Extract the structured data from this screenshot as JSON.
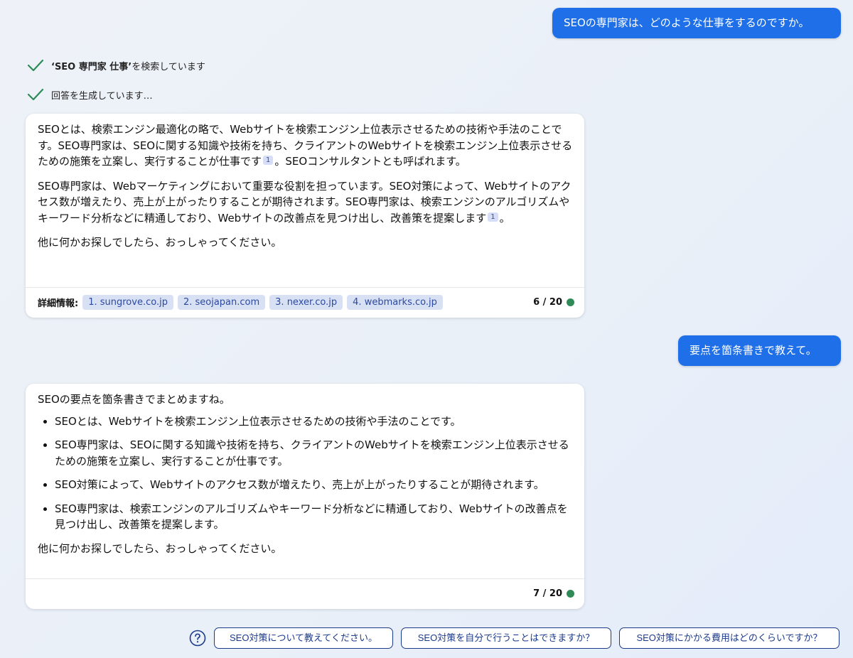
{
  "conversation": {
    "user_message_1": "SEOの専門家は、どのような仕事をするのですか。",
    "status_1_query": "‘SEO 専門家 仕事’",
    "status_1_suffix": " を検索しています",
    "status_2": "回答を生成しています…",
    "answer_1": {
      "p1_a": "SEOとは、検索エンジン最適化の略で、Webサイトを検索エンジン上位表示させるための技術や手法のことです。SEO専門家は、SEOに関する知識や技術を持ち、クライアントのWebサイトを検索エンジン上位表示させるための施策を立案し、実行することが仕事です",
      "p1_ref": "1",
      "p1_b": "。SEOコンサルタントとも呼ばれます。",
      "p2_a": "SEO専門家は、Webマーケティングにおいて重要な役割を担っています。SEO対策によって、Webサイトのアクセス数が増えたり、売上が上がったりすることが期待されます。SEO専門家は、検索エンジンのアルゴリズムやキーワード分析などに精通しており、Webサイトの改善点を見つけ出し、改善策を提案します",
      "p2_ref": "1",
      "p2_b": "。",
      "p3": "他に何かお探しでしたら、おっしゃってください。",
      "footer_label": "詳細情報:",
      "sources": [
        "1. sungrove.co.jp",
        "2. seojapan.com",
        "3. nexer.co.jp",
        "4. webmarks.co.jp"
      ],
      "counter": "6 / 20"
    },
    "user_message_2": "要点を箇条書きで教えて。",
    "answer_2": {
      "intro": "SEOの要点を箇条書きでまとめますね。",
      "bullets": [
        "SEOとは、Webサイトを検索エンジン上位表示させるための技術や手法のことです。",
        "SEO専門家は、SEOに関する知識や技術を持ち、クライアントのWebサイトを検索エンジン上位表示させるための施策を立案し、実行することが仕事です。",
        "SEO対策によって、Webサイトのアクセス数が増えたり、売上が上がったりすることが期待されます。",
        "SEO専門家は、検索エンジンのアルゴリズムやキーワード分析などに精通しており、Webサイトの改善点を見つけ出し、改善策を提案します。"
      ],
      "closing": "他に何かお探しでしたら、おっしゃってください。",
      "counter": "7 / 20"
    }
  },
  "suggestions": [
    "SEO対策について教えてください。",
    "SEO対策を自分で行うことはできますか？",
    "SEO対策にかかる費用はどのくらいですか？"
  ],
  "icons": {
    "status_check": "checkmark-icon",
    "counter_dot": "status-dot-icon",
    "suggestion_help": "question-mark-icon"
  },
  "colors": {
    "user_bubble": "#1e6fe8",
    "check_green": "#2e8b57",
    "source_chip": "#d8e0f4",
    "suggestion_border": "#1c3a8a"
  }
}
